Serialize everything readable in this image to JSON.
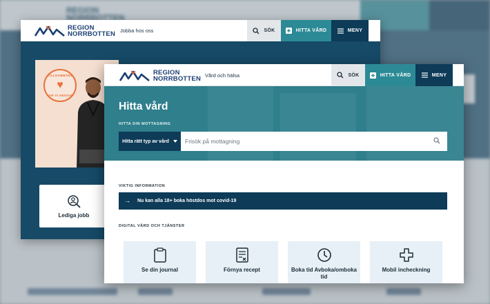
{
  "background_site": {
    "logo_text_line1": "REGION",
    "logo_text_line2": "NORRBOTTEN"
  },
  "back_window": {
    "logo": {
      "line1": "REGION",
      "line2": "NORRBOTTEN"
    },
    "header": {
      "tagline": "Jobba hos oss",
      "search_label": "SÖK",
      "find_care_label": "HITTA VÅRD",
      "menu_label": "MENY"
    },
    "hero": {
      "badge_top": "TILLSAMMANS",
      "badge_bottom": "TAR VI ANSVAR"
    },
    "jobs_card_label": "Lediga jobb"
  },
  "front_window": {
    "logo": {
      "line1": "REGION",
      "line2": "NORRBOTTEN"
    },
    "header": {
      "tagline": "Vård och hälsa",
      "search_label": "SÖK",
      "find_care_label": "HITTA VÅRD",
      "menu_label": "MENY"
    },
    "page_title": "Hitta vård",
    "find_clinic_label": "HITTA DIN MOTTAGNING",
    "type_select_label": "Hitta rätt typ av vård",
    "search_placeholder": "Frisök på mottagning",
    "important_info_label": "VIKTIG INFORMATION",
    "alert_text": "Nu kan alla 18+ boka höstdos mot covid-19",
    "digital_services_label": "DIGITAL VÅRD OCH TJÄNSTER",
    "services": [
      {
        "label": "Se din journal",
        "icon": "clipboard-icon"
      },
      {
        "label": "Förnya recept",
        "icon": "prescription-icon"
      },
      {
        "label": "Boka tid Avboka/omboka tid",
        "icon": "clock-icon"
      },
      {
        "label": "Mobil incheckning",
        "icon": "cross-icon"
      }
    ]
  },
  "colors": {
    "navy": "#0d3b58",
    "teal": "#2c8a96",
    "teal_band": "#2f7f8d",
    "card_bg": "#e7f0f6",
    "orange": "#e8733a"
  }
}
